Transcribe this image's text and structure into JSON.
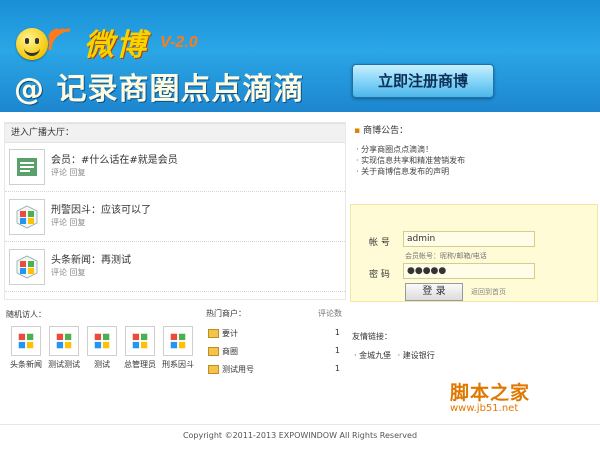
{
  "header": {
    "brand": "微博",
    "version": "V-2.0",
    "slogan": "@ 记录商圈点点滴滴",
    "register_button": "立即注册商博"
  },
  "plaza": {
    "title": "进入广播大厅：",
    "items": [
      {
        "text": "会员：#什么话在#就是会员",
        "reply": "评论 回复"
      },
      {
        "text": "刑警因斗：应该可以了",
        "reply": "评论 回复"
      },
      {
        "text": "头条新闻：再测试",
        "reply": "评论 回复"
      }
    ]
  },
  "notice": {
    "title": "商博公告：",
    "items": [
      "· 分享商圈点点滴滴！",
      "· 实现信息共享和精准营销发布",
      "· 关于商博信息发布的声明"
    ]
  },
  "login": {
    "username_label": "帐 号",
    "username_value": "admin",
    "hint": "会员帐号：昵称/邮箱/电话",
    "password_label": "密 码",
    "password_value": "●●●●●",
    "submit_label": "登 录",
    "back_link": "返回到首页"
  },
  "active_users": {
    "title": "随机访人：",
    "users": [
      "头条新闻",
      "测试测试",
      "测试",
      "总管理员",
      "刑系因斗"
    ]
  },
  "topics": {
    "title": "热门商户：",
    "right_label": "评论数",
    "items": [
      {
        "name": "要计",
        "count": "1"
      },
      {
        "name": "商圈",
        "count": "1"
      },
      {
        "name": "测试用号",
        "count": "1"
      }
    ]
  },
  "quick": {
    "title": "友情链接：",
    "links": [
      "· 金城九堡",
      "· 建设银行"
    ]
  },
  "watermark": {
    "title": "脚本之家",
    "url": "www.jb51.net"
  },
  "footer": {
    "copyright": "Copyright ©2011-2013 EXPOWINDOW All Rights Reserved"
  },
  "colors": {
    "header_blue": "#1d86cf",
    "brand_yellow": "#f5d400",
    "login_bg": "#fffbd6",
    "watermark_orange": "#e07800"
  }
}
